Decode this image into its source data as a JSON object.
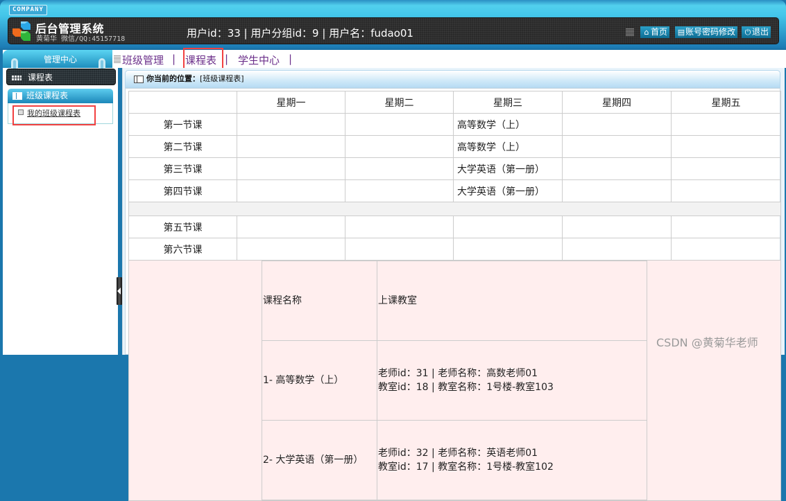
{
  "header": {
    "company_badge": "COMPANY",
    "app_title": "后台管理系统",
    "subtitle": "黄菊华 微信/QQ:45157718",
    "user_info": "用户id：33 | 用户分组id：9 | 用户名：fudao01",
    "buttons": [
      {
        "icon": "home-icon",
        "glyph": "⌂",
        "label": "首页"
      },
      {
        "icon": "list-icon",
        "glyph": "▤",
        "label": "账号密码修改"
      },
      {
        "icon": "power-icon",
        "glyph": "⏻",
        "label": "退出"
      }
    ]
  },
  "sidebar": {
    "header": "管理中心",
    "section": "课程表",
    "sub_section": "班级课程表",
    "items": [
      {
        "label": "我的班级课程表"
      }
    ]
  },
  "nav": {
    "tabs": [
      {
        "label": "班级管理"
      },
      {
        "label": "课程表"
      },
      {
        "label": "学生中心"
      }
    ],
    "separator": "|"
  },
  "breadcrumb": {
    "label": "你当前的位置：",
    "value": "[班级课程表]"
  },
  "schedule": {
    "days": [
      "星期一",
      "星期二",
      "星期三",
      "星期四",
      "星期五"
    ],
    "rows_top": [
      {
        "period": "第一节课",
        "cells": [
          "",
          "",
          "高等数学（上）",
          "",
          ""
        ]
      },
      {
        "period": "第二节课",
        "cells": [
          "",
          "",
          "高等数学（上）",
          "",
          ""
        ]
      },
      {
        "period": "第三节课",
        "cells": [
          "",
          "",
          "大学英语（第一册）",
          "",
          ""
        ]
      },
      {
        "period": "第四节课",
        "cells": [
          "",
          "",
          "大学英语（第一册）",
          "",
          ""
        ]
      }
    ],
    "rows_bottom": [
      {
        "period": "第五节课",
        "cells": [
          "",
          "",
          "",
          "",
          ""
        ]
      },
      {
        "period": "第六节课",
        "cells": [
          "",
          "",
          "",
          "",
          ""
        ]
      }
    ]
  },
  "course_info": {
    "headers": [
      "课程名称",
      "上课教室"
    ],
    "rows": [
      {
        "name": "1- 高等数学（上）",
        "line1": "老师id：31 | 老师名称：高数老师01",
        "line2": "教室id：18 | 教室名称：1号楼-教室103"
      },
      {
        "name": "2- 大学英语（第一册）",
        "line1": "老师id：32 | 老师名称：英语老师01",
        "line2": "教室id：17 | 教室名称：1号楼-教室102"
      }
    ]
  },
  "watermark": "CSDN @黄菊华老师"
}
